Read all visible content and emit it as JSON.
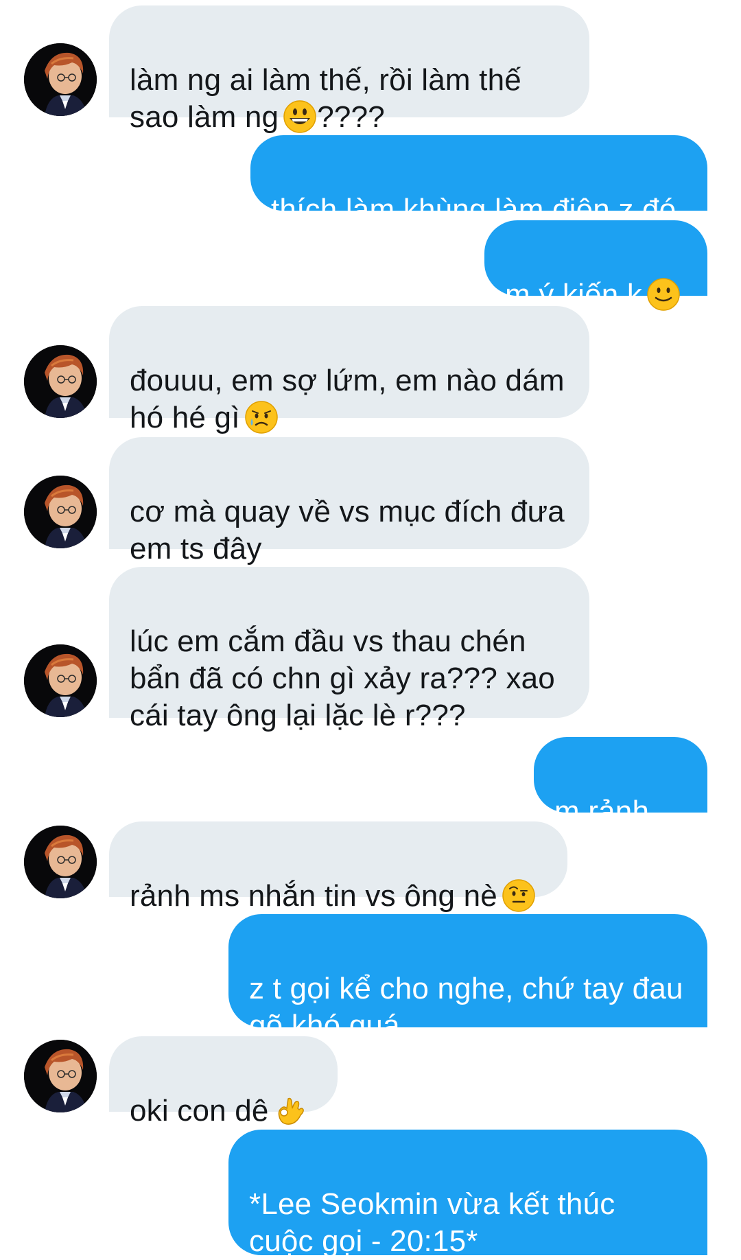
{
  "messages": [
    {
      "side": "received",
      "text": "làm ng ai làm thế, rồi làm thế\nsao làm ng",
      "emoji": "grinning-face-icon",
      "tail": "????"
    },
    {
      "side": "sent",
      "text": "thích làm khùng làm điên z đó"
    },
    {
      "side": "sent",
      "text": "m ý kiến k",
      "emoji": "slightly-smiling-face-icon"
    },
    {
      "side": "received",
      "text": "đouuu, em sợ lứm, em nào dám\nhó hé gì",
      "emoji": "sad-relieved-face-icon"
    },
    {
      "side": "received",
      "text": "cơ mà quay về vs mục đích đưa\nem ts đây"
    },
    {
      "side": "received",
      "text": "lúc em cắm đầu vs thau chén\nbẩn đã có chn gì xảy ra??? xao\ncái tay ông lại lặc lè r???"
    },
    {
      "side": "sent",
      "text": "m rảnh k?"
    },
    {
      "side": "received",
      "text": "rảnh ms nhắn tin vs ông nè",
      "emoji": "raised-eyebrow-face-icon"
    },
    {
      "side": "sent",
      "text": "z t gọi kể cho nghe, chứ tay đau\ngõ khó quá"
    },
    {
      "side": "received",
      "text": "oki con dê",
      "emoji": "ok-hand-icon"
    },
    {
      "side": "sent",
      "text": "*Lee Seokmin vừa kết thúc\ncuộc gọi - 20:15*"
    }
  ],
  "colors": {
    "sent_bubble": "#1da1f2",
    "received_bubble": "#e6ecf0",
    "sent_text": "#ffffff",
    "received_text": "#14171a"
  }
}
